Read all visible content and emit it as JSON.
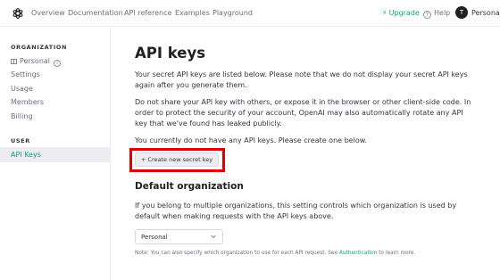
{
  "nav": {
    "links": [
      "Overview",
      "Documentation",
      "API reference",
      "Examples",
      "Playground"
    ],
    "upgrade": "Upgrade",
    "help": "Help",
    "avatar_initial": "T",
    "user_name": "Personal"
  },
  "sidebar": {
    "org_heading": "ORGANIZATION",
    "org_name": "Personal",
    "org_items": [
      "Settings",
      "Usage",
      "Members",
      "Billing"
    ],
    "user_heading": "USER",
    "active_item": "API Keys"
  },
  "main": {
    "title": "API keys",
    "para1": "Your secret API keys are listed below. Please note that we do not display your secret API keys again after you generate them.",
    "para2": "Do not share your API key with others, or expose it in the browser or other client-side code. In order to protect the security of your account, OpenAI may also automatically rotate any API key that we've found has leaked publicly.",
    "para3": "You currently do not have any API keys. Please create one below.",
    "create_button": "+ Create new secret key",
    "default_org_heading": "Default organization",
    "default_org_desc": "If you belong to multiple organizations, this setting controls which organization is used by default when making requests with the API keys above.",
    "org_select_value": "Personal",
    "note_prefix": "Note: You can also specify which organization to use for each API request. See ",
    "note_link": "Authentication",
    "note_suffix": " to learn more."
  },
  "colors": {
    "accent": "#10a37f",
    "highlight": "#e00000"
  }
}
